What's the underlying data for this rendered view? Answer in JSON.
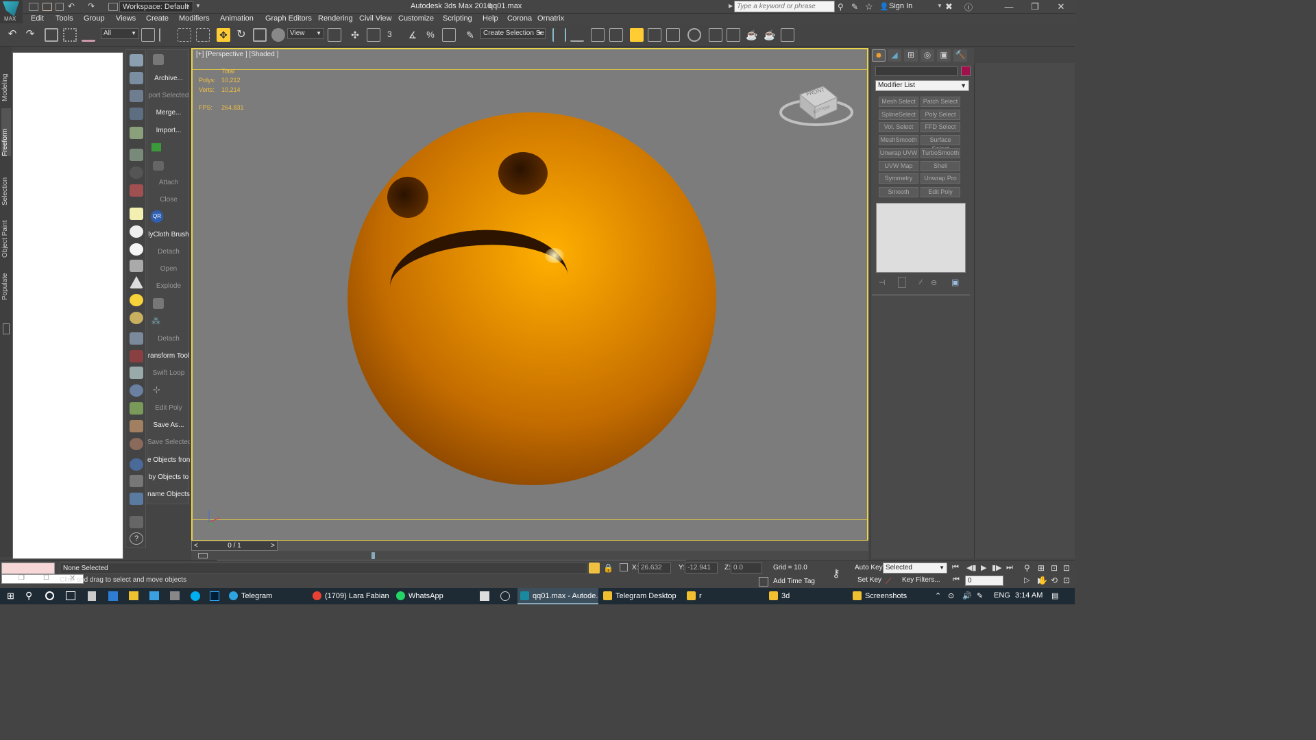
{
  "app": {
    "logo_label": "MAX",
    "title": "Autodesk 3ds Max 2016",
    "file": "qq01.max",
    "workspace": "Workspace: Default"
  },
  "search": {
    "placeholder": "Type a keyword or phrase"
  },
  "account": {
    "sign_in": "Sign In"
  },
  "menu": [
    "Edit",
    "Tools",
    "Group",
    "Views",
    "Create",
    "Modifiers",
    "Animation",
    "Graph Editors",
    "Rendering",
    "Civil View",
    "Customize",
    "Scripting",
    "Help",
    "Corona",
    "Ornatrix"
  ],
  "toolbar": {
    "filter": "All",
    "ref_coord": "View",
    "snap_label": "3",
    "named_selection": "Create Selection Se"
  },
  "vtabs": [
    "Modeling",
    "Freeform",
    "Selection",
    "Object Paint",
    "Populate"
  ],
  "commands": [
    {
      "label": "Archive...",
      "enabled": true
    },
    {
      "label": "port Selected",
      "enabled": false
    },
    {
      "label": "Merge...",
      "enabled": true
    },
    {
      "label": "Import...",
      "enabled": true
    },
    {
      "label": "Attach",
      "enabled": false
    },
    {
      "label": "Close",
      "enabled": false
    },
    {
      "label": "QR",
      "enabled": true
    },
    {
      "label": "lyCloth Brush",
      "enabled": true
    },
    {
      "label": "Detach",
      "enabled": false
    },
    {
      "label": "Open",
      "enabled": false
    },
    {
      "label": "Explode",
      "enabled": false
    },
    {
      "label": "Detach",
      "enabled": false
    },
    {
      "label": "ransform Tool",
      "enabled": true
    },
    {
      "label": "Swift Loop",
      "enabled": false
    },
    {
      "label": "Edit Poly",
      "enabled": false
    },
    {
      "label": "Save As...",
      "enabled": true
    },
    {
      "label": "Save Selected",
      "enabled": false
    },
    {
      "label": "e Objects fron",
      "enabled": true
    },
    {
      "label": "by Objects to",
      "enabled": true
    },
    {
      "label": "name Objects",
      "enabled": true
    }
  ],
  "viewport": {
    "label": "[+] [Perspective ] [Shaded ]",
    "stats": {
      "total_label": "Total",
      "polys_label": "Polys:",
      "polys": "10,212",
      "verts_label": "Verts:",
      "verts": "10,214",
      "fps_label": "FPS:",
      "fps": "264.831"
    },
    "viewcube_front": "FRONT",
    "viewcube_bottom": "BOTTOM"
  },
  "timeslider": {
    "frame": "0 / 1",
    "prev": "<",
    "next": ">"
  },
  "command_panel": {
    "modifier_list": "Modifier List",
    "swatch_color": "#a0104a",
    "modifiers": [
      "Mesh Select",
      "Patch Select",
      "SplineSelect",
      "Poly Select",
      "Vol. Select",
      "FFD Select",
      "MeshSmooth",
      "Surface Select",
      "Unwrap UVW",
      "TurboSmooth",
      "UVW Map",
      "Shell",
      "Symmetry",
      "Unwrap Pro",
      "Smooth",
      "Edit Poly"
    ]
  },
  "status": {
    "selection": "None Selected",
    "prompt": "Click and drag to select and move objects",
    "x_label": "X:",
    "x": "26.632",
    "y_label": "Y:",
    "y": "-12.941",
    "z_label": "Z:",
    "z": "0.0",
    "grid": "Grid = 10.0",
    "add_time_tag": "Add Time Tag",
    "auto_key": "Auto Key",
    "set_key": "Set Key",
    "key_mode": "Selected",
    "key_filters": "Key Filters...",
    "frame": "0"
  },
  "taskbar": {
    "items": [
      "Telegram",
      "(1709) Lara Fabian ...",
      "WhatsApp",
      "qq01.max - Autode...",
      "Telegram Desktop",
      "r",
      "3d",
      "Screenshots"
    ],
    "lang": "ENG",
    "time": "3:14 AM"
  }
}
